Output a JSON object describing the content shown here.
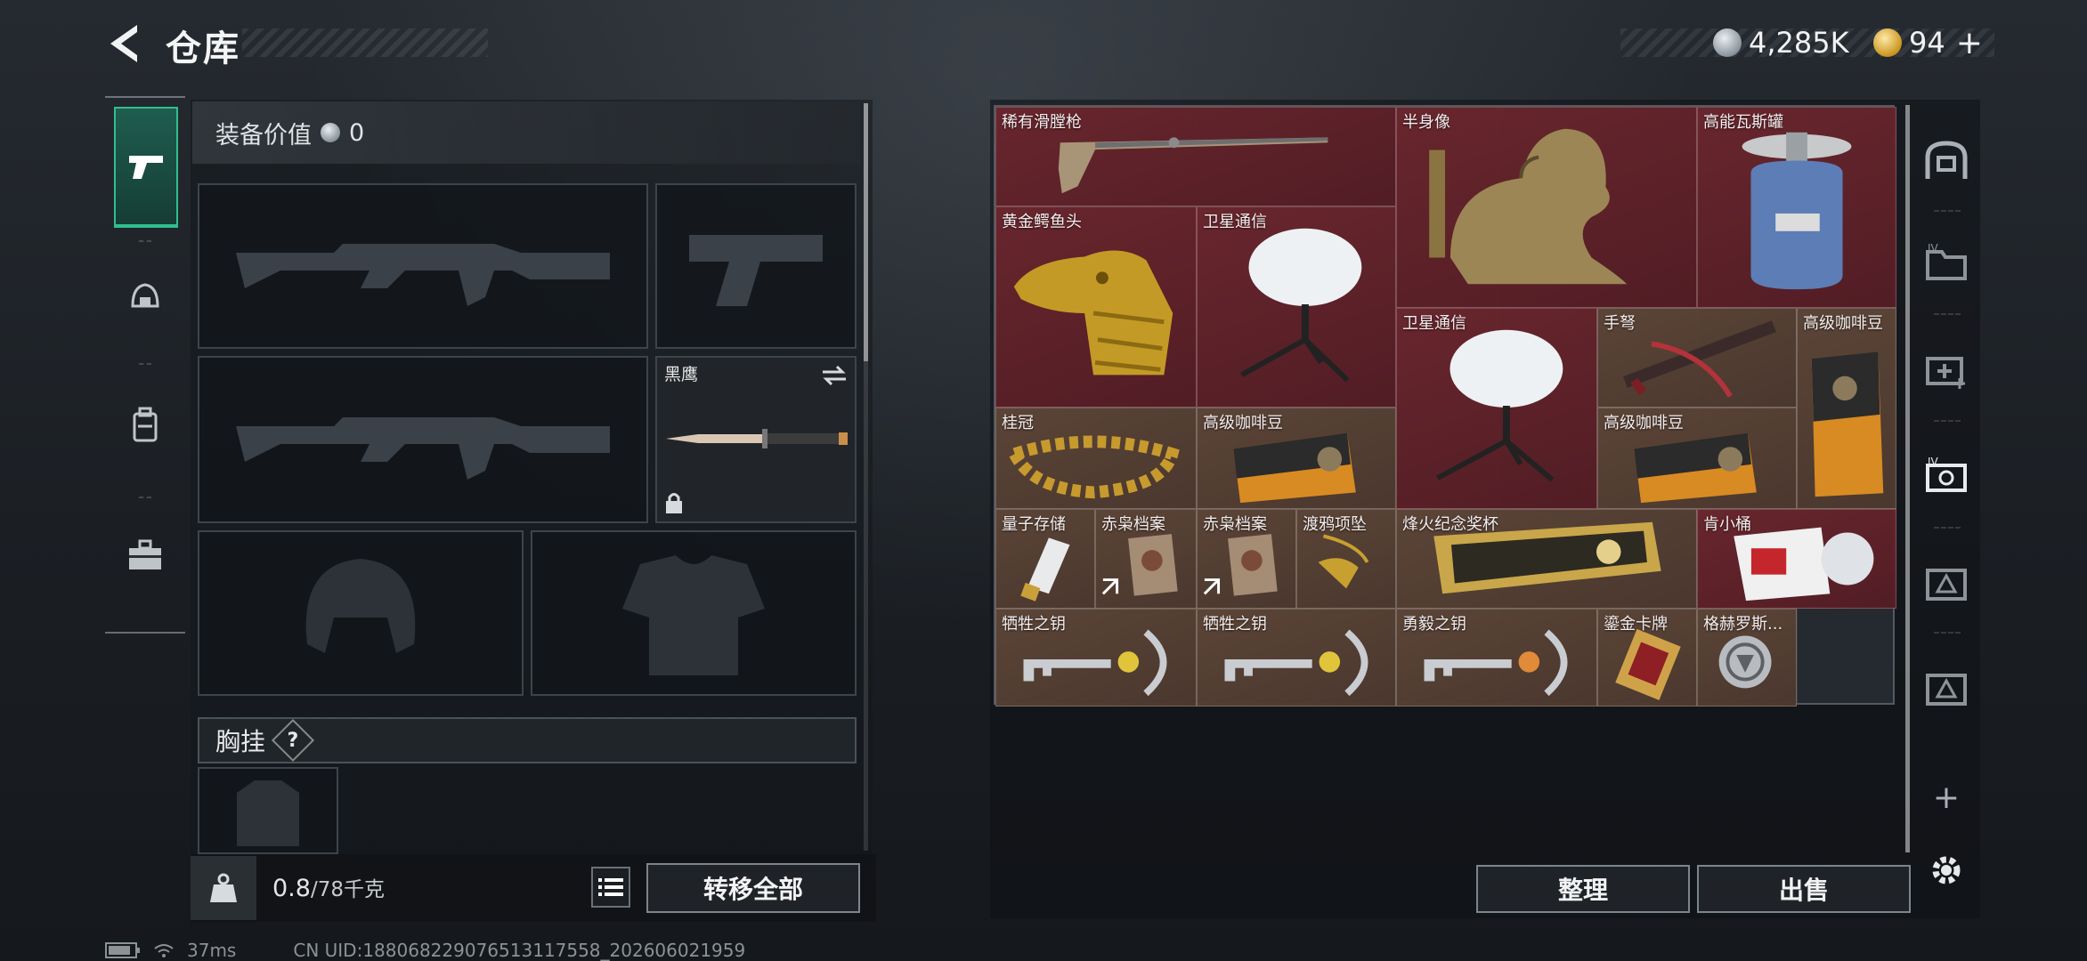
{
  "header": {
    "title": "仓库",
    "currency_silver": "4,285K",
    "currency_gold": "94"
  },
  "left_nav": {
    "items": [
      "pistol-icon",
      "helmet-icon",
      "backpack-icon",
      "toolbox-icon"
    ],
    "active": "pistol-icon"
  },
  "loadout": {
    "value_label": "装备价值",
    "value": "0",
    "melee_label": "黑鹰",
    "chest_rig_label": "胸挂",
    "help_symbol": "?",
    "weight_current": "0.8",
    "weight_max": "/78千克",
    "transfer_all": "转移全部"
  },
  "stash": {
    "items": [
      {
        "name": "稀有滑膛枪",
        "color": "red",
        "icon": "musket"
      },
      {
        "name": "半身像",
        "color": "red",
        "icon": "bust"
      },
      {
        "name": "高能瓦斯罐",
        "color": "red",
        "icon": "gas-canister"
      },
      {
        "name": "黄金鳄鱼头",
        "color": "red",
        "icon": "gold-crocodile-head"
      },
      {
        "name": "卫星通信",
        "color": "red",
        "icon": "satellite-dish"
      },
      {
        "name": "卫星通信",
        "color": "red",
        "icon": "satellite-dish"
      },
      {
        "name": "手弩",
        "color": "brown",
        "icon": "crossbow"
      },
      {
        "name": "高级咖啡豆",
        "color": "brown",
        "icon": "coffee-bag"
      },
      {
        "name": "桂冠",
        "color": "brown",
        "icon": "laurel-crown"
      },
      {
        "name": "高级咖啡豆",
        "color": "brown",
        "icon": "coffee-bag"
      },
      {
        "name": "高级咖啡豆",
        "color": "brown",
        "icon": "coffee-bag"
      },
      {
        "name": "量子存储",
        "color": "brown",
        "icon": "usb-drive"
      },
      {
        "name": "赤枭档案",
        "color": "brown",
        "icon": "dossier"
      },
      {
        "name": "赤枭档案",
        "color": "brown",
        "icon": "dossier"
      },
      {
        "name": "渡鸦项坠",
        "color": "brown",
        "icon": "raven-pendant"
      },
      {
        "name": "烽火纪念奖杯",
        "color": "brown",
        "icon": "trophy"
      },
      {
        "name": "肯小桶",
        "color": "red",
        "icon": "bucket"
      },
      {
        "name": "牺牲之钥",
        "color": "brown",
        "icon": "ornate-key"
      },
      {
        "name": "牺牲之钥",
        "color": "brown",
        "icon": "ornate-key"
      },
      {
        "name": "勇毅之钥",
        "color": "brown",
        "icon": "ornate-key"
      },
      {
        "name": "鎏金卡牌",
        "color": "brown",
        "icon": "gold-card"
      },
      {
        "name": "格赫罗斯...",
        "color": "brown",
        "icon": "medallion"
      }
    ],
    "sort_label": "整理",
    "sell_label": "出售"
  },
  "right_sidebar": {
    "items": [
      "safe-box-icon",
      "folder-IV-icon",
      "medkit-icon",
      "weapon-case-IV-icon",
      "case-triangle-icon",
      "case-triangle-icon"
    ],
    "add_symbol": "+"
  },
  "status_bar": {
    "ping": "37ms",
    "uid": "CN UID:1880682290765131175​58_202606021959"
  },
  "colors": {
    "accent": "#2fbf8f",
    "rare_red": "#6c262e",
    "common_brown": "#5e4638"
  }
}
